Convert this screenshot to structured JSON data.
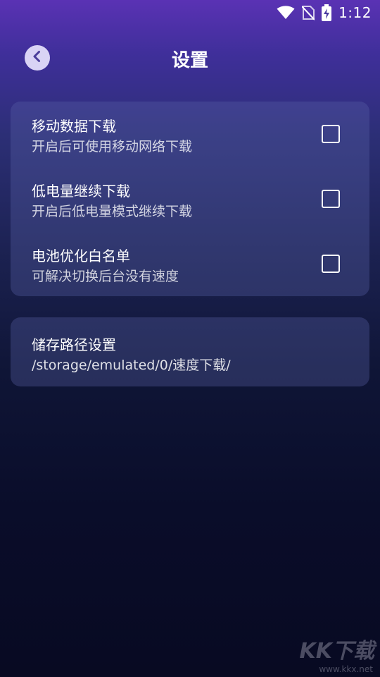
{
  "status_bar": {
    "time": "1:12",
    "icons": [
      "wifi-icon",
      "no-sim-icon",
      "battery-charging-icon"
    ]
  },
  "header": {
    "title": "设置",
    "back_icon": "chevron-left-icon"
  },
  "settings": {
    "items": [
      {
        "title": "移动数据下载",
        "subtitle": "开启后可使用移动网络下载",
        "checked": false
      },
      {
        "title": "低电量继续下载",
        "subtitle": "开启后低电量模式继续下载",
        "checked": false
      },
      {
        "title": "电池优化白名单",
        "subtitle": "可解决切换后台没有速度",
        "checked": false
      }
    ]
  },
  "storage": {
    "title": "储存路径设置",
    "path": "/storage/emulated/0/速度下载/"
  },
  "watermark": {
    "logo": "KK下载",
    "url": "www.kkx.net"
  },
  "colors": {
    "accent_top": "#5a32b4",
    "background_bottom": "#080a22",
    "card": "#3a4278",
    "back_button": "#d9d3f5"
  }
}
